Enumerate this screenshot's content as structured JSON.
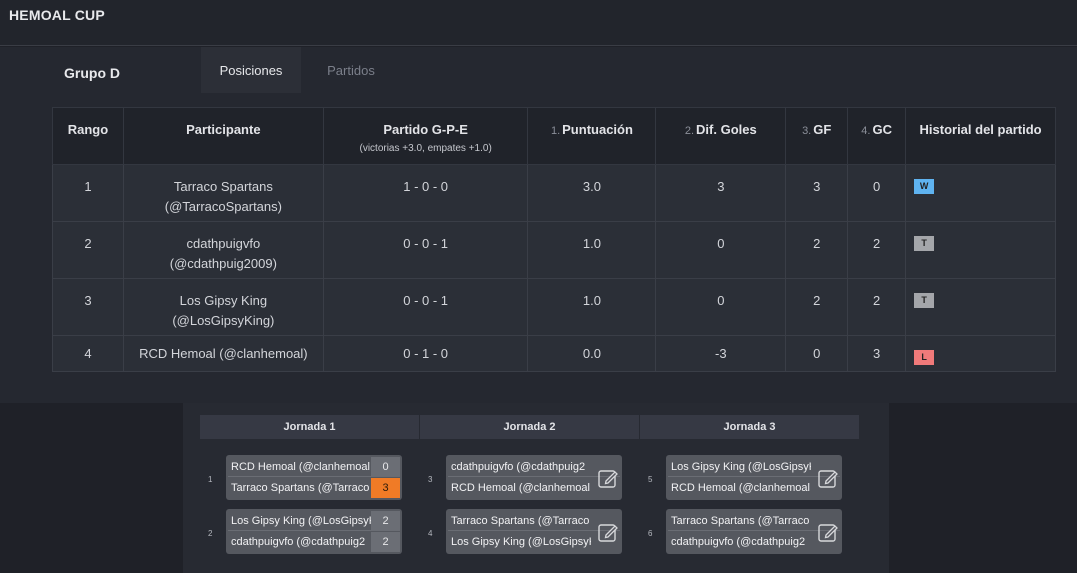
{
  "app": {
    "title": "HEMOAL CUP"
  },
  "group": {
    "title": "Grupo D"
  },
  "tabs": [
    {
      "label": "Posiciones",
      "active": true
    },
    {
      "label": "Partidos",
      "active": false
    }
  ],
  "standings": {
    "headers": {
      "rank": "Rango",
      "participant": "Participante",
      "match": "Partido G-P-E",
      "match_sub": "(victorias +3.0, empates +1.0)",
      "points_num": "1.",
      "points": "Puntuación",
      "diff_num": "2.",
      "diff": "Dif. Goles",
      "gf_num": "3.",
      "gf": "GF",
      "gc_num": "4.",
      "gc": "GC",
      "history": "Historial del partido"
    },
    "rows": [
      {
        "rank": "1",
        "name": "Tarraco Spartans",
        "handle": "(@TarracoSpartans)",
        "record": "1 - 0 - 0",
        "points": "3.0",
        "diff": "3",
        "gf": "3",
        "gc": "0",
        "history": "W"
      },
      {
        "rank": "2",
        "name": "cdathpuigvfo",
        "handle": "(@cdathpuig2009)",
        "record": "0 - 0 - 1",
        "points": "1.0",
        "diff": "0",
        "gf": "2",
        "gc": "2",
        "history": "T"
      },
      {
        "rank": "3",
        "name": "Los Gipsy King",
        "handle": "(@LosGipsyKing)",
        "record": "0 - 0 - 1",
        "points": "1.0",
        "diff": "0",
        "gf": "2",
        "gc": "2",
        "history": "T"
      },
      {
        "rank": "4",
        "name": "RCD Hemoal (@clanhemoal)",
        "handle": "",
        "record": "0 - 1 - 0",
        "points": "0.0",
        "diff": "-3",
        "gf": "0",
        "gc": "3",
        "history": "L"
      }
    ]
  },
  "bracket": {
    "rounds": [
      "Jornada 1",
      "Jornada 2",
      "Jornada 3"
    ],
    "matches": [
      {
        "num": "1",
        "top": "RCD Hemoal (@clanhemoal",
        "top_score": "0",
        "bottom": "Tarraco Spartans (@Tarraco",
        "bottom_score": "3"
      },
      {
        "num": "2",
        "top": "Los Gipsy King (@LosGipsyK",
        "top_score": "2",
        "bottom": "cdathpuigvfo (@cdathpuig2",
        "bottom_score": "2"
      },
      {
        "num": "3",
        "top": "cdathpuigvfo (@cdathpuig2",
        "bottom": "RCD Hemoal (@clanhemoal"
      },
      {
        "num": "4",
        "top": "Tarraco Spartans (@Tarraco",
        "bottom": "Los Gipsy King (@LosGipsyK"
      },
      {
        "num": "5",
        "top": "Los Gipsy King (@LosGipsyK",
        "bottom": "RCD Hemoal (@clanhemoal"
      },
      {
        "num": "6",
        "top": "Tarraco Spartans (@Tarraco",
        "bottom": "cdathpuigvfo (@cdathpuig2"
      }
    ]
  },
  "colors": {
    "win_badge": "#5fb3f0",
    "tie_badge": "#a4a6aa",
    "loss_badge": "#f07a7a",
    "win_score": "#f07b26"
  },
  "icons": {
    "edit": "edit-icon"
  }
}
